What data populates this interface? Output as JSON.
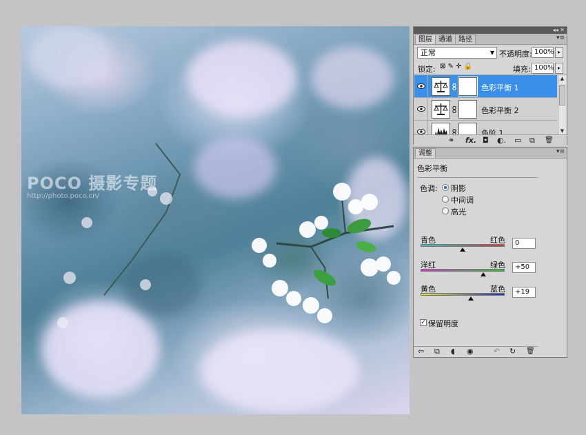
{
  "watermark": {
    "brand": "POCO 摄影专题",
    "url": "http://photo.poco.cn/"
  },
  "layers_panel": {
    "top_controls": "◂◂ ✕",
    "tabs": [
      "图层",
      "通道",
      "路径"
    ],
    "blend_mode": "正常",
    "opacity_label": "不透明度:",
    "opacity_value": "100%",
    "lock_label": "锁定:",
    "fill_label": "填充:",
    "fill_value": "100%",
    "layers": [
      {
        "name": "色彩平衡 1",
        "selected": true,
        "icon": "balance-scale-icon"
      },
      {
        "name": "色彩平衡 2",
        "selected": false,
        "icon": "balance-scale-icon"
      },
      {
        "name": "色阶 1",
        "selected": false,
        "icon": "levels-histogram-icon"
      }
    ],
    "footer_icons": [
      "link-icon",
      "fx-icon",
      "mask-icon",
      "adjustment-icon",
      "folder-icon",
      "new-layer-icon",
      "trash-icon"
    ],
    "footer_glyphs": [
      "⚭",
      "fx.",
      "◘",
      "◐.",
      "▭",
      "⧉",
      "🗑"
    ]
  },
  "adjust_panel": {
    "tab": "调整",
    "title": "色彩平衡",
    "tone_label": "色调:",
    "tones": [
      "阴影",
      "中间调",
      "高光"
    ],
    "selected_tone": 0,
    "sliders": [
      {
        "left": "青色",
        "right": "红色",
        "value": "0",
        "level": 0,
        "colors": [
          "#31c6c9",
          "#d0333a"
        ]
      },
      {
        "left": "洋红",
        "right": "绿色",
        "value": "+50",
        "level": 50,
        "colors": [
          "#d330cf",
          "#28c42e"
        ]
      },
      {
        "left": "黄色",
        "right": "蓝色",
        "value": "+19",
        "level": 19,
        "colors": [
          "#e6e62f",
          "#2332c4"
        ]
      }
    ],
    "preserve_label": "保留明度",
    "preserve_checked": true,
    "footer_icons": [
      "back-arrow-icon",
      "view-icon",
      "clip-icon",
      "eye-icon",
      "reset-prev-icon",
      "reset-icon",
      "trash-icon"
    ],
    "footer_glyphs": [
      "⇦",
      "⧉",
      "◖",
      "◉",
      "↶",
      "↻",
      "🗑"
    ]
  }
}
